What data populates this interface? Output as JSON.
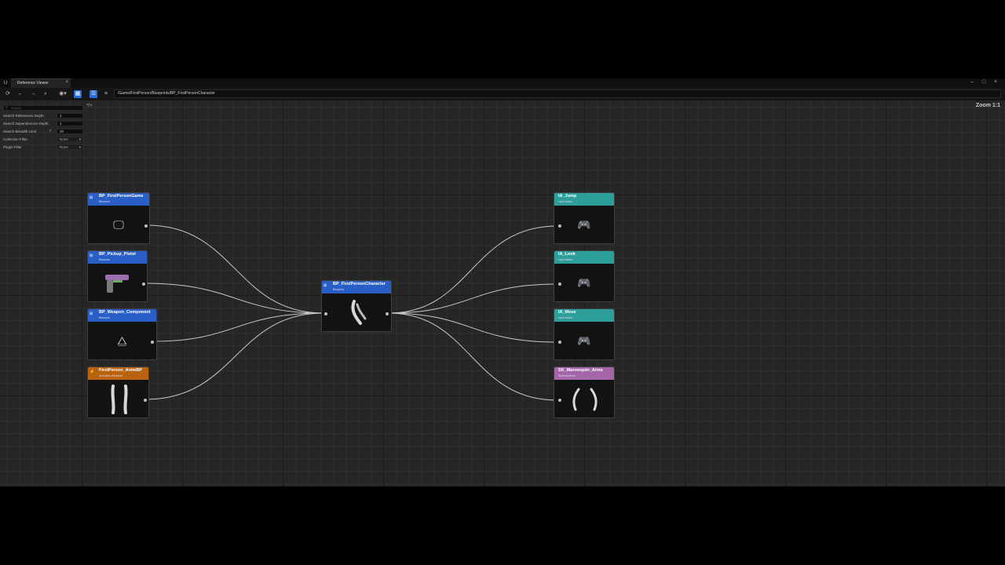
{
  "window": {
    "tab_label": "Reference Viewer",
    "tab_close": "×",
    "controls": [
      "–",
      "□",
      "×"
    ]
  },
  "toolbar": {
    "path": "/Game/FirstPerson/Blueprints/BP_FirstPersonCharacter",
    "icons": [
      "refresh-icon",
      "back-icon",
      "forward-icon",
      "find-path-icon",
      "show-options-icon",
      "view-mode-icon",
      "filter-icon",
      "list-icon"
    ]
  },
  "graph": {
    "zoom": "Zoom 1:1"
  },
  "settings": {
    "search_placeholder": "Search",
    "rows": [
      {
        "label": "Search References Depth",
        "value": "1"
      },
      {
        "label": "Search Dependencies Depth",
        "value": "1"
      },
      {
        "label": "Search Breadth Limit",
        "value": "20",
        "checked": "✓"
      },
      {
        "label": "Collection Filter",
        "value": "None"
      },
      {
        "label": "Plugin Filter",
        "value": "None"
      }
    ]
  },
  "nodes": {
    "game": {
      "title": "BP_FirstPersonGame",
      "type": "Blueprint",
      "color": "#2a5ec7"
    },
    "pistol": {
      "title": "BP_Pickup_Pistol",
      "type": "Blueprint",
      "color": "#2a5ec7"
    },
    "weapon": {
      "title": "BP_Weapon_Component",
      "type": "Blueprint",
      "color": "#2a5ec7"
    },
    "anim": {
      "title": "FirstPerson_AnimBP",
      "type": "Animation Blueprint",
      "color": "#b9620f"
    },
    "center": {
      "title": "BP_FirstPersonCharacter",
      "type": "Blueprint",
      "color": "#2a5ec7"
    },
    "jump": {
      "title": "IA_Jump",
      "type": "Input Action",
      "color": "#2e9e9b"
    },
    "look": {
      "title": "IA_Look",
      "type": "Input Action",
      "color": "#2e9e9b"
    },
    "move": {
      "title": "IA_Move",
      "type": "Input Action",
      "color": "#2e9e9b"
    },
    "arms": {
      "title": "SK_Mannequin_Arms",
      "type": "Skeletal Mesh",
      "color": "#a466a8"
    }
  }
}
